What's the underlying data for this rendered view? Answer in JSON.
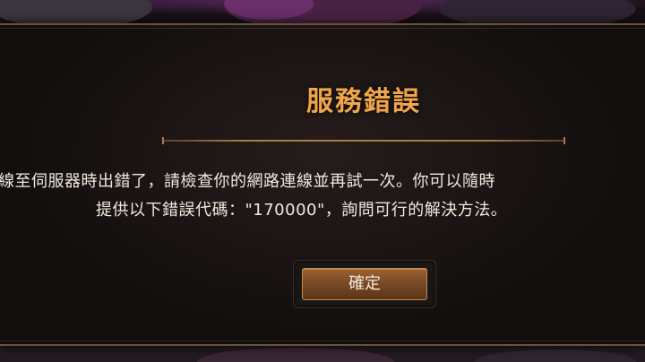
{
  "dialog": {
    "title": "服務錯誤",
    "message_line_1": "線至伺服器時出錯了，請檢查你的網路連線並再試一次。你可以隨時",
    "message_line_2": "提供以下錯誤代碼：\"170000\"，詢問可行的解決方法。",
    "confirm_label": "確定"
  },
  "colors": {
    "title": "#f1a64b",
    "accent_border": "#6a5334",
    "button_border": "#c98a4a",
    "text": "#efe8dc"
  }
}
